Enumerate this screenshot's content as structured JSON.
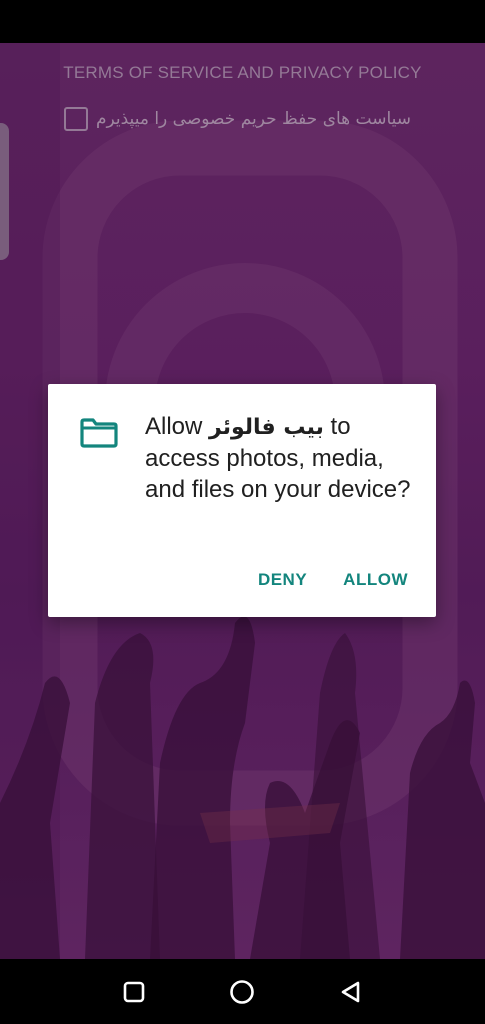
{
  "background": {
    "terms_title": "TERMS OF SERVICE AND PRIVACY POLICY",
    "accept_label": "سیاست های حفظ حریم خصوصی را میپذیرم",
    "accept_checked": false
  },
  "dialog": {
    "icon": "folder-icon",
    "message_prefix": "Allow ",
    "app_name": "بیب فالوئر",
    "message_suffix": " to access photos, media, and files on your device?",
    "deny_label": "DENY",
    "allow_label": "ALLOW",
    "accent_color": "#13857d"
  },
  "nav": {
    "recents_icon": "square-icon",
    "home_icon": "circle-icon",
    "back_icon": "triangle-back-icon"
  }
}
